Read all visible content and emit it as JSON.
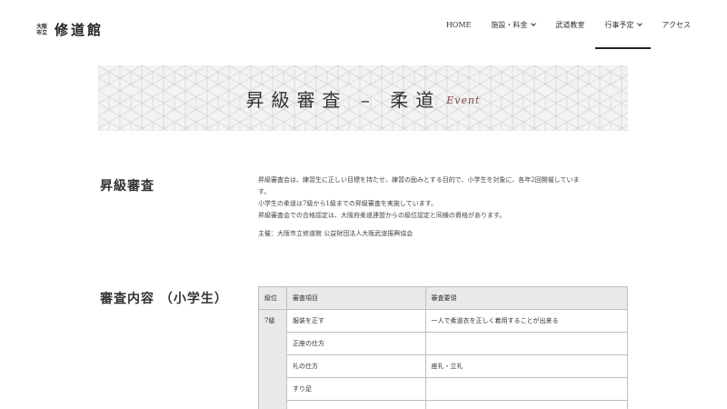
{
  "logo": {
    "small_line1": "大阪",
    "small_line2": "市立",
    "main": "修道館"
  },
  "nav": {
    "items": [
      {
        "label": "HOME",
        "has_dropdown": false,
        "active": false
      },
      {
        "label": "施設・料金",
        "has_dropdown": true,
        "active": false
      },
      {
        "label": "武道教室",
        "has_dropdown": false,
        "active": false
      },
      {
        "label": "行事予定",
        "has_dropdown": true,
        "active": true
      },
      {
        "label": "アクセス",
        "has_dropdown": false,
        "active": false
      }
    ]
  },
  "banner": {
    "title": "昇級審査 – 柔道",
    "subtitle": "Event"
  },
  "section1": {
    "heading": "昇級審査",
    "paragraphs": [
      "昇級審査会は、練習生に正しい目標を持たせ、練習の励みとする目的で、小学生を対象に、各年2回開催していま",
      "す。",
      "小学生の柔道は7級から1級までの昇級審査を実施しています。",
      "昇級審査会での合格認定は、大阪府柔道連盟からの級位認定と同様の資格があります。"
    ],
    "host": "主催：大阪市立修道館 公益財団法人大阪武道振興協会"
  },
  "section2": {
    "heading": "審査内容 （小学生）",
    "table": {
      "headers": [
        "級位",
        "審査項目",
        "審査要領"
      ],
      "grade": "7級",
      "rows": [
        {
          "item": "服装を正す",
          "method": "一人で柔道衣を正しく着用することが出来る"
        },
        {
          "item": "正座の仕方",
          "method": ""
        },
        {
          "item": "礼の仕方",
          "method": "座礼・立礼"
        },
        {
          "item": "すり足",
          "method": ""
        },
        {
          "item": "",
          "method": ""
        }
      ]
    }
  },
  "colors": {
    "banner_bg": "#f3f3f3",
    "pattern_line": "#d2d2d2",
    "table_header_bg": "#e9e9e9",
    "table_border": "#bfbfbf",
    "event_accent": "#7a4a4a"
  }
}
